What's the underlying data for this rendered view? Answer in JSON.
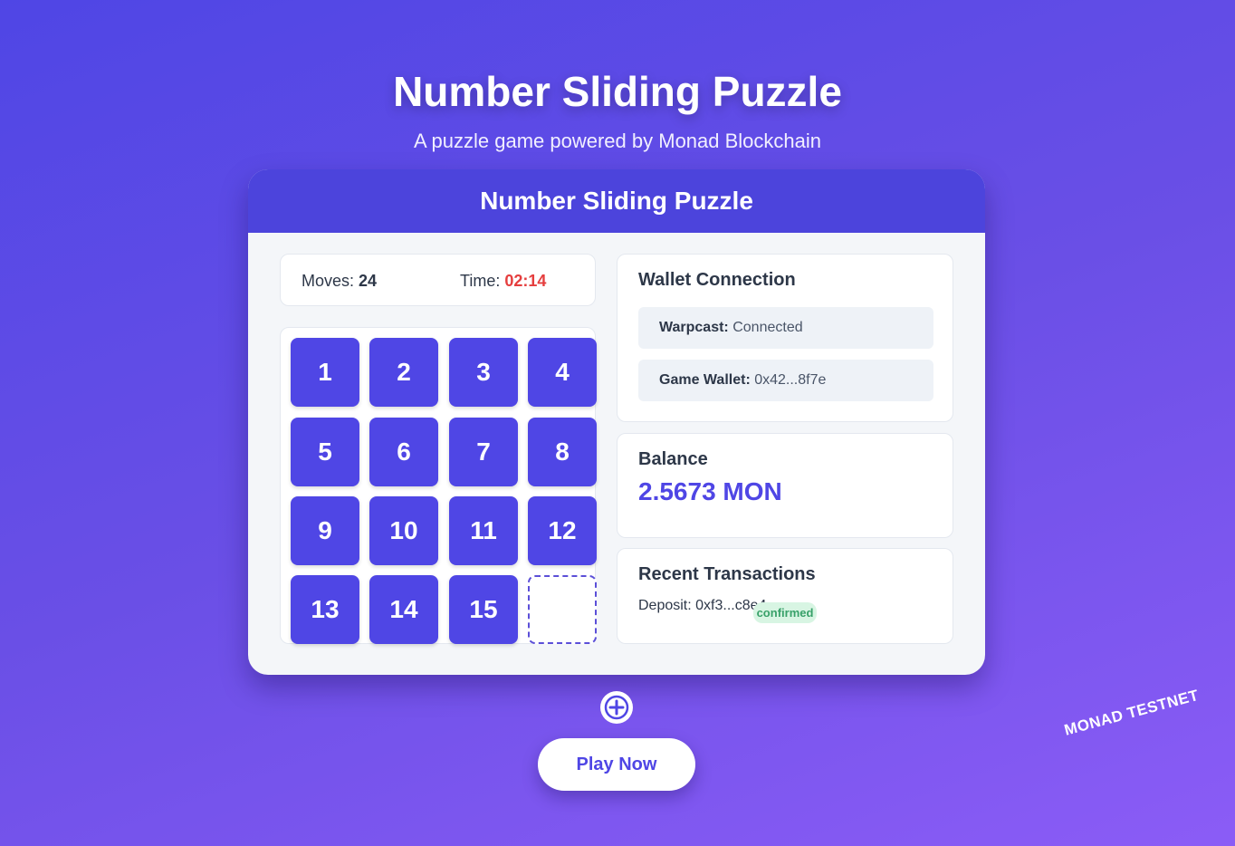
{
  "header": {
    "title": "Number Sliding Puzzle",
    "subtitle": "A puzzle game powered by Monad Blockchain"
  },
  "game": {
    "card_title": "Number Sliding Puzzle",
    "moves_label": "Moves:",
    "moves_value": "24",
    "time_label": "Time:",
    "time_value": "02:14",
    "tiles": [
      "1",
      "2",
      "3",
      "4",
      "5",
      "6",
      "7",
      "8",
      "9",
      "10",
      "11",
      "12",
      "13",
      "14",
      "15",
      ""
    ]
  },
  "wallet": {
    "title": "Wallet Connection",
    "warpcast_label": "Warpcast:",
    "warpcast_value": "Connected",
    "game_wallet_label": "Game Wallet:",
    "game_wallet_value": "0x42...8f7e"
  },
  "balance": {
    "title": "Balance",
    "value": "2.5673 MON"
  },
  "transactions": {
    "title": "Recent Transactions",
    "items": [
      {
        "text": "Deposit: 0xf3...c8e4",
        "status": "confirmed"
      }
    ]
  },
  "actions": {
    "add_icon": "plus-circle-icon",
    "play_label": "Play Now"
  },
  "network_badge": "MONAD TESTNET",
  "colors": {
    "accent": "#4f46e5",
    "header": "#4c44dc",
    "time": "#e53e3e",
    "status_confirmed": "#38a169"
  }
}
